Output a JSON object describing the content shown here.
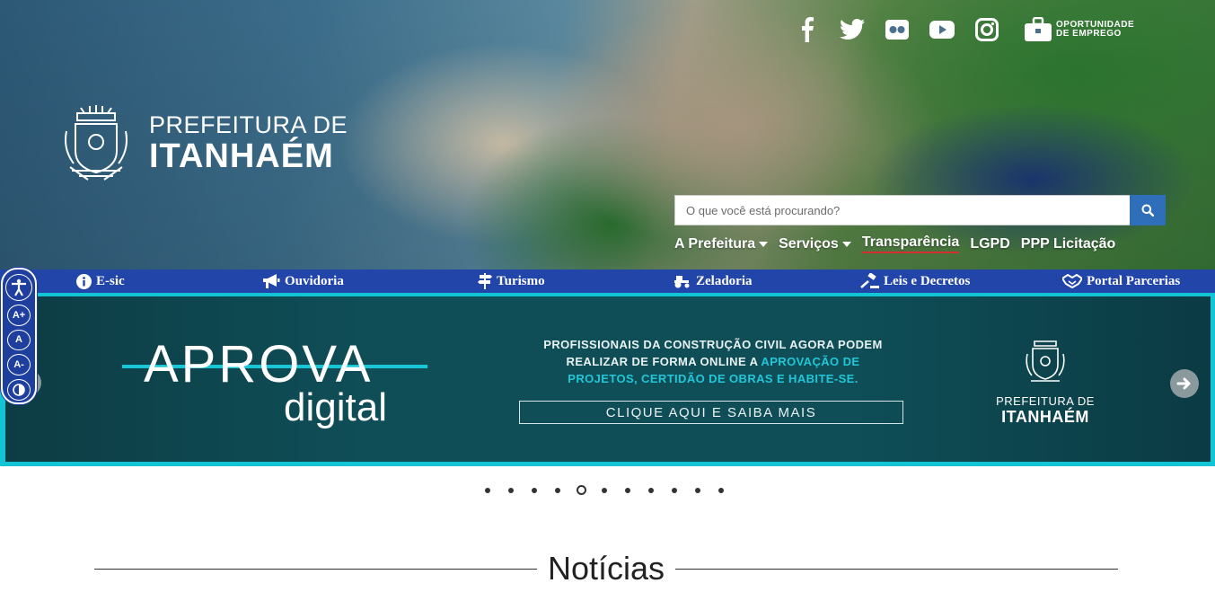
{
  "header": {
    "logo_line1": "PREFEITURA DE",
    "logo_line2": "ITANHAÉM",
    "social": [
      "facebook-icon",
      "twitter-icon",
      "flickr-icon",
      "youtube-icon",
      "instagram-icon"
    ],
    "emprego_line1": "OPORTUNIDADE",
    "emprego_line2": "DE EMPREGO",
    "search_placeholder": "O que você está procurando?",
    "menu": [
      {
        "label": "A Prefeitura"
      },
      {
        "label": "Serviços"
      },
      {
        "label": "Transparência"
      },
      {
        "label": "LGPD"
      },
      {
        "label": "PPP Licitação"
      }
    ]
  },
  "navbar": {
    "items": [
      {
        "label": "E-sic",
        "icon": "info-icon"
      },
      {
        "label": "Ouvidoria",
        "icon": "megaphone-icon"
      },
      {
        "label": "Turismo",
        "icon": "signpost-icon"
      },
      {
        "label": "Zeladoria",
        "icon": "tractor-icon"
      },
      {
        "label": "Leis e Decretos",
        "icon": "gavel-icon"
      },
      {
        "label": "Portal Parcerias",
        "icon": "handshake-icon"
      }
    ]
  },
  "accessibility": {
    "buttons": [
      "A+",
      "A",
      "A-"
    ]
  },
  "banner": {
    "aprova": "APROVA",
    "digital": "digital",
    "text_part1": "PROFISSIONAIS DA CONSTRUÇÃO CIVIL AGORA PODEM REALIZAR DE FORMA ONLINE A ",
    "text_highlight": "APROVAÇÃO DE PROJETOS, CERTIDÃO DE OBRAS E HABITE-SE.",
    "cta": "CLIQUE AQUI E SAIBA MAIS",
    "logo_line1": "PREFEITURA DE",
    "logo_line2": "ITANHAÉM",
    "accent_color": "#22c6d8"
  },
  "carousel": {
    "total": 11,
    "active_index": 4
  },
  "section": {
    "title": "Notícias"
  }
}
